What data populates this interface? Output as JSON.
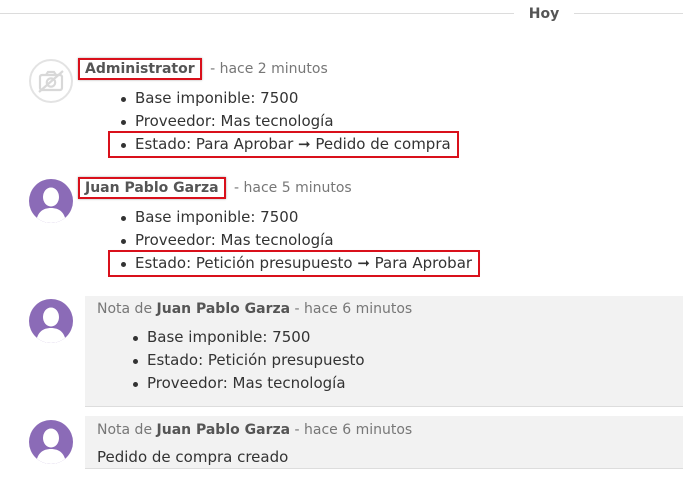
{
  "divider": {
    "label": "Hoy"
  },
  "messages": [
    {
      "author": "Administrator",
      "separator": "-",
      "time": "hace 2 minutos",
      "items": [
        "Base imponible: 7500",
        "Proveedor: Mas tecnología",
        "Estado: Para Aprobar ➞ Pedido de compra"
      ]
    },
    {
      "author": "Juan Pablo Garza",
      "separator": "-",
      "time": "hace 5 minutos",
      "items": [
        "Base imponible: 7500",
        "Proveedor: Mas tecnología",
        "Estado: Petición presupuesto ➞ Para Aprobar"
      ]
    }
  ],
  "notes": [
    {
      "prefix": "Nota de",
      "author": "Juan Pablo Garza",
      "separator": "-",
      "time": "hace 6 minutos",
      "items": [
        "Base imponible: 7500",
        "Estado: Petición presupuesto",
        "Proveedor: Mas tecnología"
      ]
    },
    {
      "prefix": "Nota de",
      "author": "Juan Pablo Garza",
      "separator": "-",
      "time": "hace 6 minutos",
      "body": "Pedido de compra creado"
    }
  ],
  "colors": {
    "highlight_border": "#d9101b",
    "avatar_purple": "#8b6bb7",
    "note_background": "#f2f2f2"
  },
  "icons": {
    "admin_avatar": "camera-icon",
    "user_avatar": "user-silhouette-icon"
  }
}
